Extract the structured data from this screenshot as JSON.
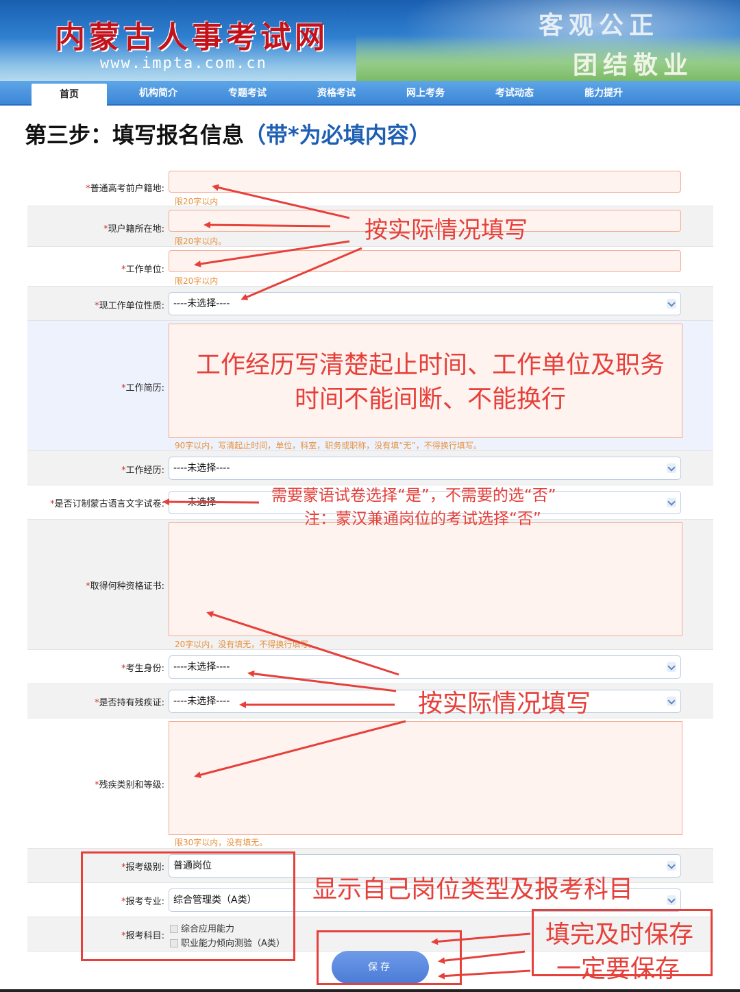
{
  "header": {
    "site_title": "内蒙古人事考试网",
    "site_url": "www.impta.com.cn",
    "slogan_line1": "客观公正",
    "slogan_line2": "团结敬业"
  },
  "nav": {
    "items": [
      "首页",
      "机构简介",
      "专题考试",
      "资格考试",
      "网上考务",
      "考试动态",
      "能力提升"
    ],
    "active": "首页"
  },
  "page": {
    "heading": "第三步：填写报名信息",
    "heading_hint": "（带*为必填内容）"
  },
  "form": {
    "required_mark": "*",
    "fields": {
      "gaokao_huji": {
        "label": "普通高考前户籍地:",
        "help": "限20字以内"
      },
      "current_huji": {
        "label": "现户籍所在地:",
        "help": "限20字以内。"
      },
      "employer": {
        "label": "工作单位:",
        "help": "限20字以内"
      },
      "employer_nature": {
        "label": "现工作单位性质:",
        "value": "----未选择----"
      },
      "resume": {
        "label": "工作简历:",
        "help": "90字以内，写清起止时间，单位，科室，职务或职称，没有填“无”，不得换行填写。"
      },
      "work_experience": {
        "label": "工作经历:",
        "value": "----未选择----"
      },
      "mongolian_paper": {
        "label": "是否订制蒙古语言文字试卷:",
        "value": "----未选择----"
      },
      "certificates": {
        "label": "取得何种资格证书:",
        "help": "20字以内，没有填无，不得换行填写。"
      },
      "identity": {
        "label": "考生身份:",
        "value": "----未选择----"
      },
      "disability_card": {
        "label": "是否持有残疾证:",
        "value": "----未选择----"
      },
      "disability_level": {
        "label": "残疾类别和等级:",
        "help": "限30字以内，没有填无。"
      },
      "exam_level": {
        "label": "报考级别:",
        "value": "普通岗位"
      },
      "exam_major": {
        "label": "报考专业:",
        "value": "综合管理类（A类）"
      },
      "exam_subjects": {
        "label": "报考科目:",
        "items": [
          "综合应用能力",
          "职业能力倾向测验（A类）"
        ]
      }
    },
    "save_label": "保存"
  },
  "annotations": {
    "fill_actual_1": "按实际情况填写",
    "resume_note_line1": "工作经历写清楚起止时间、工作单位及职务",
    "resume_note_line2": "时间不能间断、不能换行",
    "mongolian_note_line1": "需要蒙语试卷选择“是”，不需要的选“否”",
    "mongolian_note_line2": "注：蒙汉兼通岗位的考试选择“否”",
    "fill_actual_2": "按实际情况填写",
    "position_note": "显示自己岗位类型及报考科目",
    "save_note_line1": "填完及时保存",
    "save_note_line2": "一定要保存"
  },
  "colors": {
    "annotation_red": "#e6403a",
    "required_red": "#d12f2f",
    "help_orange": "#e8913d",
    "heading_blue": "#1e5fb4",
    "save_button_blue": "#4a7bd6"
  }
}
